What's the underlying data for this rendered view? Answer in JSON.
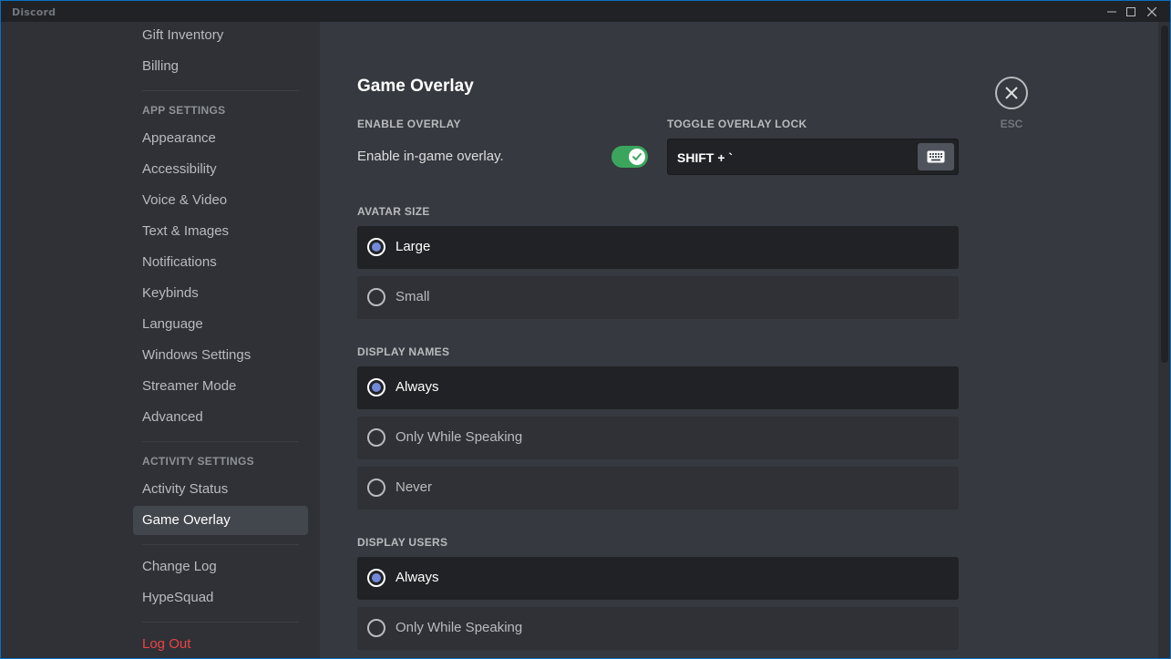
{
  "app": {
    "title": "Discord"
  },
  "window_controls": {
    "minimize_icon": "minimize-icon",
    "maximize_icon": "maximize-icon",
    "close_icon": "close-icon"
  },
  "sidebar": {
    "items_top": [
      "Gift Inventory",
      "Billing"
    ],
    "app_settings_header": "APP SETTINGS",
    "app_settings": [
      "Appearance",
      "Accessibility",
      "Voice & Video",
      "Text & Images",
      "Notifications",
      "Keybinds",
      "Language",
      "Windows Settings",
      "Streamer Mode",
      "Advanced"
    ],
    "activity_settings_header": "ACTIVITY SETTINGS",
    "activity_settings": [
      "Activity Status",
      "Game Overlay"
    ],
    "selected": "Game Overlay",
    "misc": [
      "Change Log",
      "HypeSquad"
    ],
    "logout": "Log Out"
  },
  "main": {
    "title": "Game Overlay",
    "enable_overlay": {
      "header": "ENABLE OVERLAY",
      "label": "Enable in-game overlay.",
      "enabled": true
    },
    "toggle_lock": {
      "header": "TOGGLE OVERLAY LOCK",
      "value": "SHIFT + `",
      "icon": "keyboard-icon"
    },
    "avatar_size": {
      "header": "AVATAR SIZE",
      "options": [
        "Large",
        "Small"
      ],
      "selected": "Large"
    },
    "display_names": {
      "header": "DISPLAY NAMES",
      "options": [
        "Always",
        "Only While Speaking",
        "Never"
      ],
      "selected": "Always"
    },
    "display_users": {
      "header": "DISPLAY USERS",
      "options": [
        "Always",
        "Only While Speaking"
      ],
      "selected": "Always"
    },
    "close": {
      "hint": "ESC",
      "icon": "close-icon"
    }
  },
  "colors": {
    "accent": "#7289da",
    "toggle_on": "#3ba55d",
    "danger": "#ed4245"
  }
}
